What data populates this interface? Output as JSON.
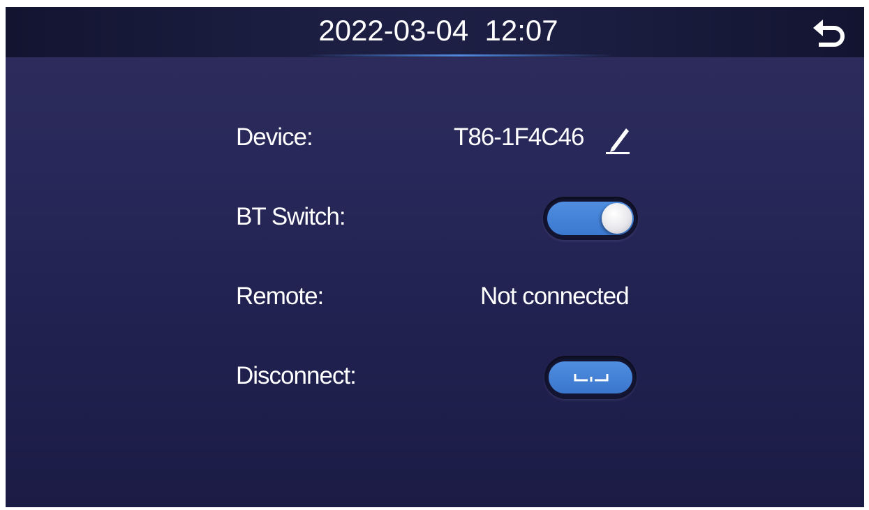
{
  "header": {
    "datetime": "2022-03-04  12:07",
    "back_icon": "back-arrow-icon"
  },
  "settings": {
    "device": {
      "label": "Device:",
      "value": "T86-1F4C46",
      "edit_icon": "pencil-icon"
    },
    "bt_switch": {
      "label": "BT Switch:",
      "state": "on"
    },
    "remote": {
      "label": "Remote:",
      "value": "Not connected"
    },
    "disconnect": {
      "label": "Disconnect:",
      "icon": "unlink-icon"
    }
  },
  "colors": {
    "accent": "#4a88dc",
    "background": "#25255a",
    "topbar": "#1a1c3e"
  }
}
